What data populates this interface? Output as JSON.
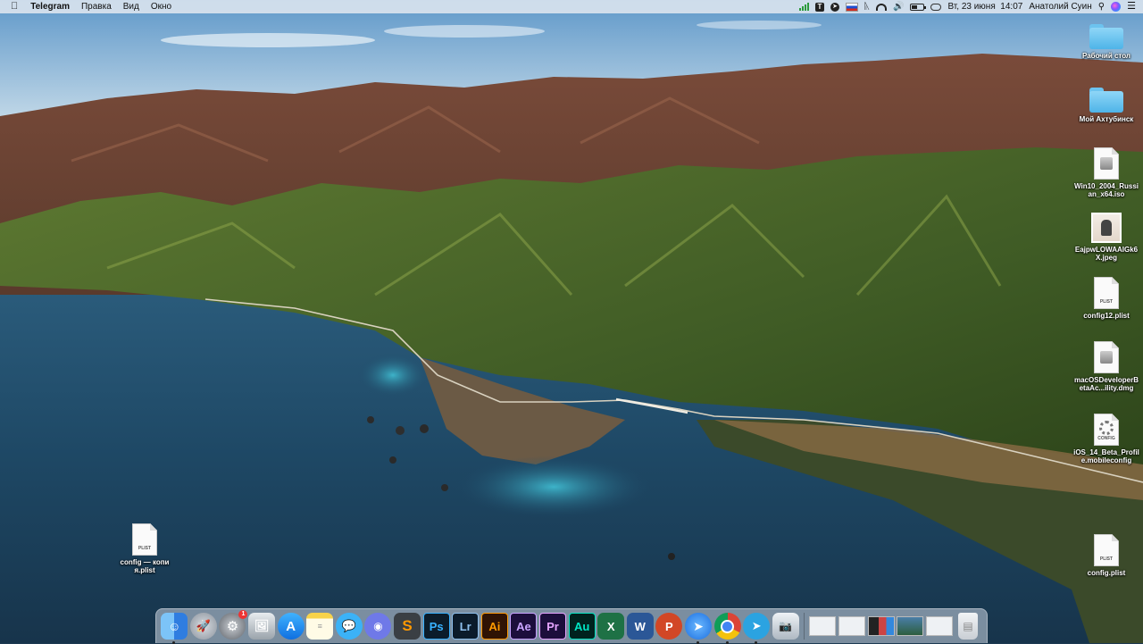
{
  "menubar": {
    "app_name": "Telegram",
    "menus": [
      "Правка",
      "Вид",
      "Окно"
    ],
    "datetime": "Вт, 23 июня  14:07",
    "user": "Анатолий Суин",
    "status_icons": [
      "signal-icon",
      "t-app-icon",
      "telegram-status-icon",
      "flag-ru-icon",
      "bluetooth-icon",
      "wifi-icon",
      "volume-icon",
      "battery-icon",
      "control-center-icon",
      "search-icon",
      "siri-icon"
    ]
  },
  "desktop": {
    "icons": [
      {
        "label": "Рабочий стол",
        "kind": "folder"
      },
      {
        "label": "Мой Ахтубинск",
        "kind": "folder"
      },
      {
        "label": "Win10_2004_Russian_x64.iso",
        "kind": "disk"
      },
      {
        "label": "EajpwLOWAAIGk6X.jpeg",
        "kind": "photo"
      },
      {
        "label": "config12.plist",
        "kind": "plist"
      },
      {
        "label": "macOSDeveloperBetaAc...ility.dmg",
        "kind": "disk"
      },
      {
        "label": "iOS_14_Beta_Profile.mobileconfig",
        "kind": "config"
      },
      {
        "label": "config.plist",
        "kind": "plist"
      },
      {
        "label": "config — копия.plist",
        "kind": "plist"
      }
    ],
    "plist_tag": "PLIST",
    "config_tag": "CONFIG"
  },
  "dock": {
    "apps": [
      {
        "name": "finder-icon",
        "color": "#3a8ef0"
      },
      {
        "name": "launchpad-icon",
        "color": "#8a929c"
      },
      {
        "name": "system-preferences-icon",
        "color": "#7b7f86",
        "badge": "1"
      },
      {
        "name": "preview-icon",
        "color": "#b0b6bd"
      },
      {
        "name": "app-store-icon",
        "color": "#1b8ff5"
      },
      {
        "name": "notes-icon",
        "color": "#f9e27a"
      },
      {
        "name": "messages-icon",
        "color": "#3bb2f7"
      },
      {
        "name": "discord-icon",
        "color": "#6f79e8"
      },
      {
        "name": "sublime-icon",
        "color": "#3a3f44"
      }
    ],
    "adobe": [
      {
        "label": "Ps",
        "bg": "#0b1c2a",
        "fg": "#38b2ff"
      },
      {
        "label": "Lr",
        "bg": "#0b1b2a",
        "fg": "#8fc1ee"
      },
      {
        "label": "Ai",
        "bg": "#2f1304",
        "fg": "#ff9a00"
      },
      {
        "label": "Ae",
        "bg": "#1c0e3c",
        "fg": "#c9a4ff"
      },
      {
        "label": "Pr",
        "bg": "#1c0e3c",
        "fg": "#e6a4ff"
      },
      {
        "label": "Au",
        "bg": "#00221e",
        "fg": "#00e5c3"
      }
    ],
    "office": [
      {
        "name": "excel-icon",
        "label": "X",
        "color": "#1e7145"
      },
      {
        "name": "word-icon",
        "label": "W",
        "color": "#2b5797"
      },
      {
        "name": "powerpoint-icon",
        "label": "P",
        "color": "#d24726"
      }
    ],
    "tail": [
      {
        "name": "xcode-instruments-icon",
        "color": "#2a84e8"
      },
      {
        "name": "chrome-icon",
        "color": "#fff"
      },
      {
        "name": "telegram-icon",
        "color": "#2ba3e1"
      },
      {
        "name": "screenshot-app-icon",
        "color": "#dce3ea"
      }
    ]
  }
}
